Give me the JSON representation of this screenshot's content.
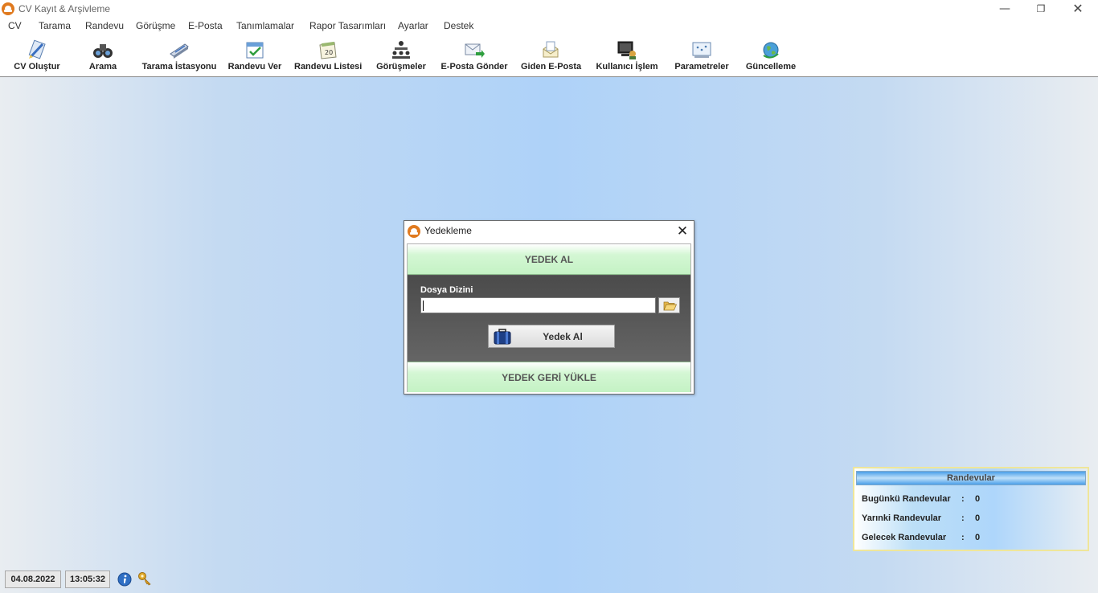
{
  "window": {
    "title": "CV Kayıt & Arşivleme",
    "minimize_glyph": "—",
    "maximize_glyph": "❐",
    "close_glyph": "✕"
  },
  "menu": [
    "CV",
    "Tarama",
    "Randevu",
    "Görüşme",
    "E-Posta",
    "Tanımlamalar",
    "Rapor Tasarımları",
    "Ayarlar",
    "Destek"
  ],
  "toolbar": [
    {
      "label": "CV Oluştur",
      "icon": "cv-create-icon"
    },
    {
      "label": "Arama",
      "icon": "binoculars-icon"
    },
    {
      "label": "Tarama İstasyonu",
      "icon": "scanner-icon"
    },
    {
      "label": "Randevu Ver",
      "icon": "calendar-check-icon"
    },
    {
      "label": "Randevu Listesi",
      "icon": "calendar-icon"
    },
    {
      "label": "Görüşmeler",
      "icon": "meeting-icon"
    },
    {
      "label": "E-Posta Gönder",
      "icon": "mail-send-icon"
    },
    {
      "label": "Giden E-Posta",
      "icon": "mail-outbox-icon"
    },
    {
      "label": "Kullanıcı İşlem",
      "icon": "user-terminal-icon"
    },
    {
      "label": "Parametreler",
      "icon": "parameters-icon"
    },
    {
      "label": "Güncelleme",
      "icon": "globe-update-icon"
    }
  ],
  "dialog": {
    "title": "Yedekleme",
    "close_glyph": "✕",
    "backup_section": "YEDEK AL",
    "path_label": "Dosya Dizini",
    "path_value": "",
    "browse_icon": "folder-open-icon",
    "backup_button": "Yedek Al",
    "backup_button_icon": "briefcase-icon",
    "restore_section": "YEDEK GERİ YÜKLE"
  },
  "status": {
    "date": "04.08.2022",
    "time": "13:05:32",
    "info_icon": "info-icon",
    "key_icon": "key-icon"
  },
  "appointments": {
    "title": "Randevular",
    "rows": [
      {
        "label": "Bugünkü Randevular",
        "sep": ":",
        "value": "0"
      },
      {
        "label": "Yarınki Randevular",
        "sep": ":",
        "value": "0"
      },
      {
        "label": "Gelecek Randevular",
        "sep": ":",
        "value": "0"
      }
    ]
  },
  "colors": {
    "app_icon": "#e07a1f",
    "section_green": "#c4f2c4",
    "panel_blue": "#4a9fe8",
    "panel_border": "#efe69a"
  }
}
